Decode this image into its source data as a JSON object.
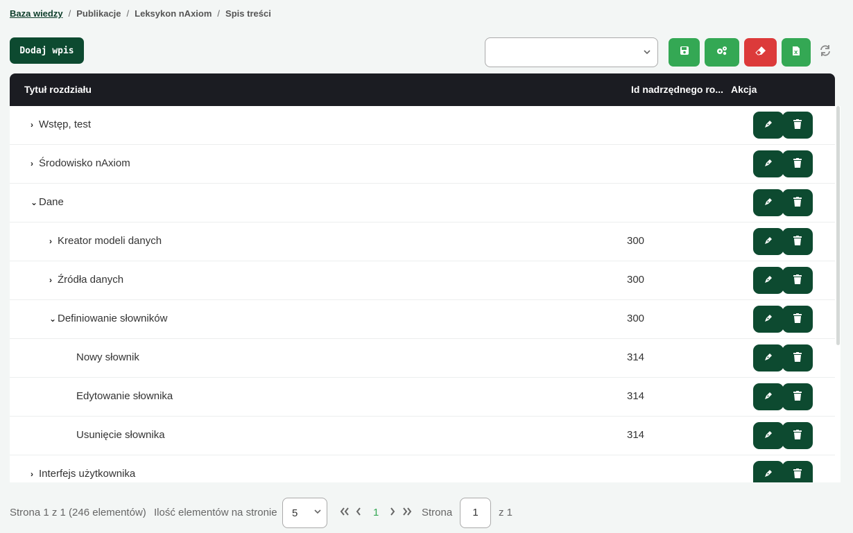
{
  "breadcrumb": [
    "Baza wiedzy",
    "Publikacje",
    "Leksykon nAxiom",
    "Spis treści"
  ],
  "toolbar": {
    "add_label": "Dodaj wpis",
    "select_value": "",
    "colors": {
      "green": "#34a854",
      "red": "#dc3a3a",
      "dark_green": "#0d4a30"
    },
    "icons": [
      "save-icon",
      "settings-icon",
      "eraser-icon",
      "excel-icon",
      "refresh-icon"
    ]
  },
  "table": {
    "headers": [
      "Tytuł rozdziału",
      "Id nadrzędnego ro...",
      "Akcja"
    ],
    "rows": [
      {
        "caret": "›",
        "title": "Wstęp, test",
        "parent_id": ""
      },
      {
        "caret": "›",
        "title": "Środowisko nAxiom",
        "parent_id": ""
      },
      {
        "caret": "⌄",
        "title": "Dane",
        "parent_id": ""
      },
      {
        "caret": "›",
        "title": "Kreator modeli danych",
        "parent_id": "300"
      },
      {
        "caret": "›",
        "title": "Źródła danych",
        "parent_id": "300"
      },
      {
        "caret": "⌄",
        "title": "Definiowanie słowników",
        "parent_id": "300"
      },
      {
        "caret": "",
        "title": "Nowy słownik",
        "parent_id": "314"
      },
      {
        "caret": "",
        "title": "Edytowanie słownika",
        "parent_id": "314"
      },
      {
        "caret": "",
        "title": "Usunięcie słownika",
        "parent_id": "314"
      },
      {
        "caret": "›",
        "title": "Interfejs użytkownika",
        "parent_id": ""
      }
    ]
  },
  "footer": {
    "summary": "Strona 1 z 1 (246 elementów)",
    "per_page_label": "Ilość elementów na stronie",
    "per_page_value": "5",
    "current_page": "1",
    "page_label": "Strona",
    "page_input": "1",
    "of_total": "z 1"
  }
}
